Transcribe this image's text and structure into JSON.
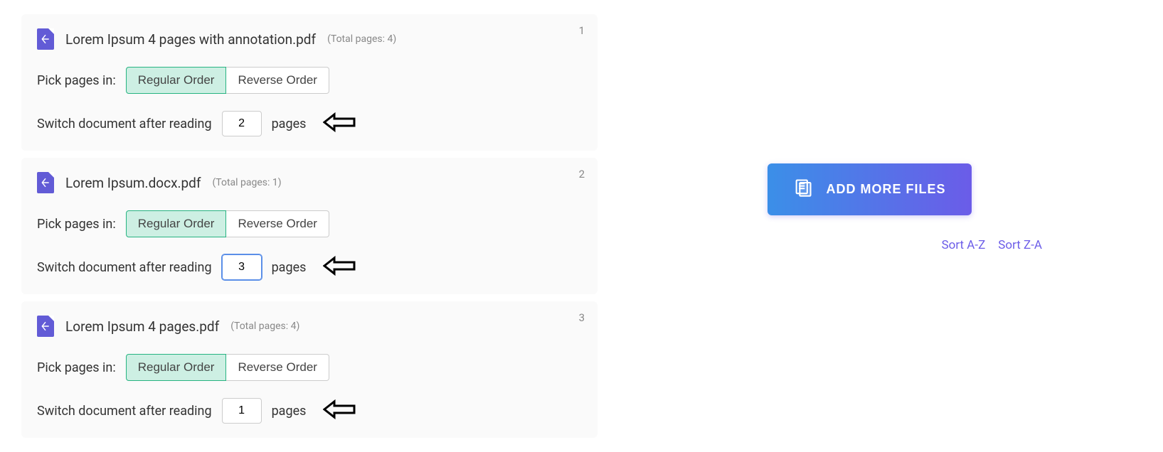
{
  "labels": {
    "pick_pages": "Pick pages in:",
    "regular_order": "Regular Order",
    "reverse_order": "Reverse Order",
    "switch_doc": "Switch document after reading",
    "pages_suffix": "pages",
    "add_more": "ADD MORE FILES",
    "sort_az": "Sort A-Z",
    "sort_za": "Sort Z-A"
  },
  "files": [
    {
      "index": "1",
      "name": "Lorem Ipsum 4 pages with annotation.pdf",
      "total_pages": "(Total pages: 4)",
      "page_value": "2",
      "input_focused": false
    },
    {
      "index": "2",
      "name": "Lorem Ipsum.docx.pdf",
      "total_pages": "(Total pages: 1)",
      "page_value": "3",
      "input_focused": true
    },
    {
      "index": "3",
      "name": "Lorem Ipsum 4 pages.pdf",
      "total_pages": "(Total pages: 4)",
      "page_value": "1",
      "input_focused": false
    }
  ]
}
